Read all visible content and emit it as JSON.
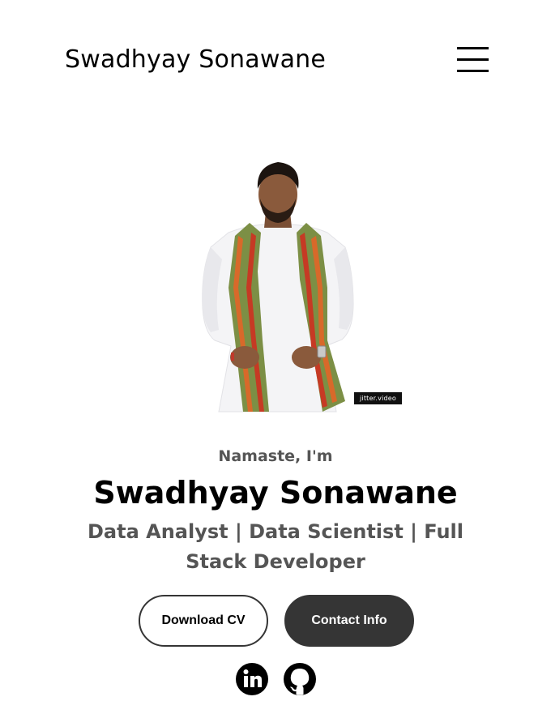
{
  "header": {
    "logo_text": "Swadhyay Sonawane",
    "menu_icon": "hamburger-menu-icon"
  },
  "hero": {
    "photo_watermark": "jitter.video",
    "greeting": "Namaste, I'm",
    "name": "Swadhyay Sonawane",
    "roles": "Data Analyst | Data Scientist | Full Stack Developer"
  },
  "buttons": {
    "download_cv": "Download CV",
    "contact_info": "Contact Info"
  },
  "social": [
    {
      "icon": "linkedin-icon"
    },
    {
      "icon": "github-icon"
    }
  ],
  "colors": {
    "text_primary": "#000000",
    "text_secondary": "#555555",
    "button_dark": "#353535",
    "background": "#ffffff"
  }
}
